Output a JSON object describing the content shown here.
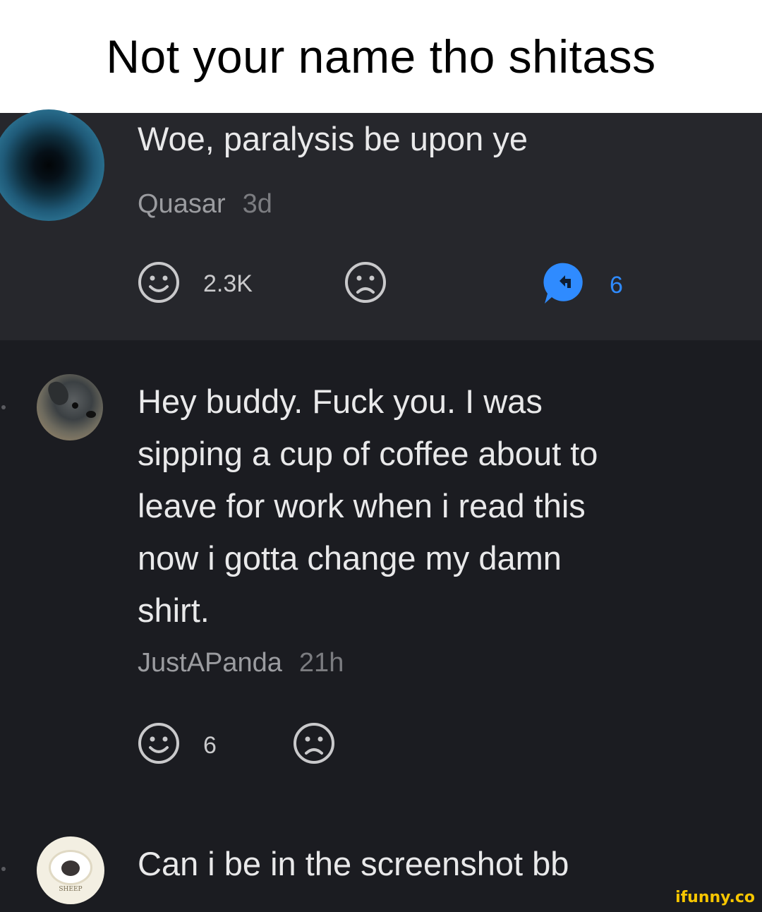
{
  "caption": "Not your name tho shitass",
  "comments": [
    {
      "text": "Woe, paralysis be upon ye",
      "author": "Quasar",
      "age": "3d",
      "likes": "2.3K",
      "replies": "6"
    },
    {
      "lines": [
        "Hey buddy. Fuck you. I was",
        "sipping a cup of coffee about to",
        "leave for work when i read this",
        "now i gotta change my damn",
        "shirt."
      ],
      "author": "JustAPanda",
      "age": "21h",
      "likes": "6"
    },
    {
      "text": "Can i be in the screenshot bb",
      "avatar_label": "SHEEP"
    }
  ],
  "watermark": "ifunny.co",
  "colors": {
    "reply_accent": "#2f8bff",
    "text": "#e9e9ea",
    "meta": "#9b9ca0"
  },
  "icons": [
    "smile-icon",
    "frown-icon",
    "reply-icon"
  ]
}
